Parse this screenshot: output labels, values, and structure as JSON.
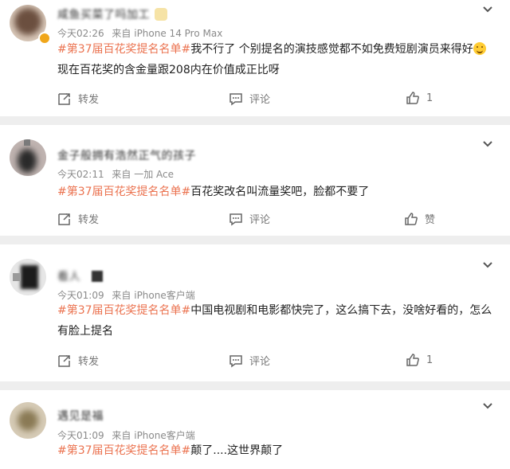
{
  "posts": [
    {
      "name": "咸鱼买菜了吗加工",
      "meta_time": "今天02:26",
      "meta_source": "来自 iPhone 14 Pro Max",
      "hashtag": "#第37届百花奖提名名单#",
      "line1_text": "我不行了 个别提名的演技感觉都不如免费短剧演员来得好",
      "line2_text": "现在百花奖的含金量跟208内在价值成正比呀",
      "repost": "转发",
      "comment": "评论",
      "like": "1"
    },
    {
      "name": "金子般拥有浩然正气的孩子",
      "meta_time": "今天02:11",
      "meta_source": "来自 一加 Ace",
      "hashtag": "#第37届百花奖提名名单#",
      "line1_text": "百花奖改名叫流量奖吧，脸都不要了",
      "repost": "转发",
      "comment": "评论",
      "like": "赞"
    },
    {
      "name": "看人",
      "meta_time": "今天01:09",
      "meta_source": "来自 iPhone客户端",
      "hashtag": "#第37届百花奖提名名单#",
      "line1_text": "中国电视剧和电影都快完了，这么搞下去，没啥好看的，怎么",
      "line2_text": "有脸上提名",
      "repost": "转发",
      "comment": "评论",
      "like": "1"
    },
    {
      "name": "遇见是福",
      "meta_time": "今天01:09",
      "meta_source": "来自 iPhone客户端",
      "hashtag": "#第37届百花奖提名名单#",
      "line1_text": "颠了....这世界颠了"
    }
  ],
  "icons": {
    "repost": "repost-icon",
    "comment": "comment-icon",
    "like": "thumbs-up-icon",
    "menu": "chevron-down-icon"
  },
  "colors": {
    "hashtag": "#eb7350",
    "meta": "#8a8a8a",
    "background": "#eeeeee"
  }
}
